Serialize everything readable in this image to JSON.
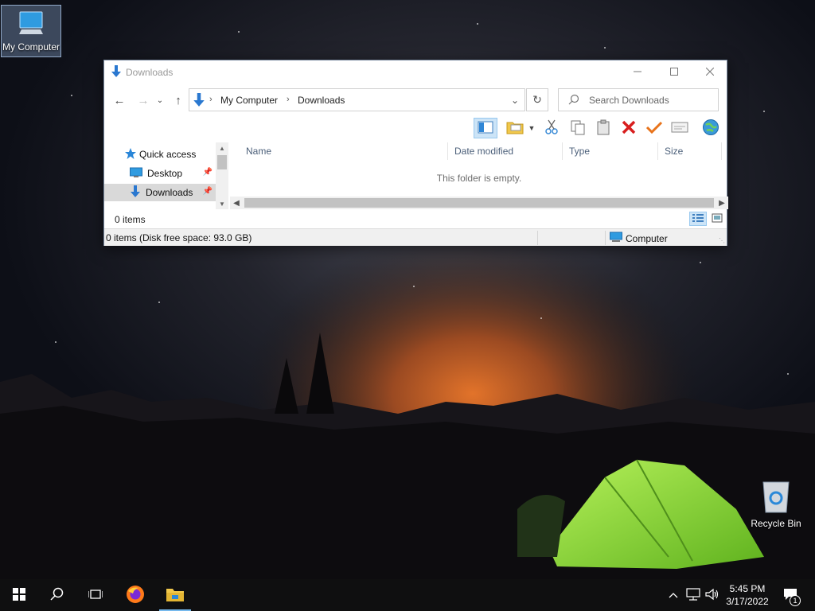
{
  "desktop": {
    "icons": [
      {
        "label": "My Computer",
        "icon": "monitor-icon"
      },
      {
        "label": "Recycle Bin",
        "icon": "recycle-bin-icon"
      }
    ]
  },
  "window": {
    "title": "Downloads",
    "controls": {
      "minimize": "minimize-icon",
      "maximize": "maximize-icon",
      "close": "close-icon"
    },
    "address": {
      "crumbs": [
        "My Computer",
        "Downloads"
      ]
    },
    "search": {
      "placeholder": "Search Downloads"
    },
    "toolbar": [
      "preview-pane-icon",
      "folder-view-icon",
      "cut-icon",
      "copy-icon",
      "paste-icon",
      "delete-icon",
      "check-icon",
      "rename-icon",
      "globe-icon"
    ],
    "sidebar": {
      "items": [
        {
          "label": "Quick access",
          "icon": "star-icon",
          "pinned": false
        },
        {
          "label": "Desktop",
          "icon": "desktop-icon",
          "pinned": true
        },
        {
          "label": "Downloads",
          "icon": "downloads-icon",
          "pinned": true,
          "selected": true
        }
      ]
    },
    "columns": [
      "Name",
      "Date modified",
      "Type",
      "Size"
    ],
    "empty_message": "This folder is empty.",
    "item_count": "0 items",
    "status": {
      "free_space": "0 items (Disk free space: 93.0 GB)",
      "location": "Computer"
    }
  },
  "taskbar": {
    "apps": [
      "start-icon",
      "search-icon",
      "task-view-icon",
      "firefox-icon",
      "file-explorer-icon"
    ],
    "clock": {
      "time": "5:45 PM",
      "date": "3/17/2022"
    },
    "notification_count": "1"
  },
  "colors": {
    "accent": "#0078d7",
    "selection": "#cce4f7",
    "taskbar": "#0f0f10",
    "tent": "#8fe03a"
  }
}
